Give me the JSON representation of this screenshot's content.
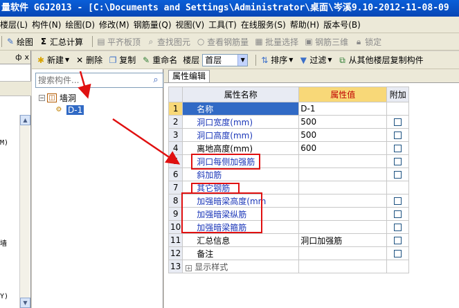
{
  "window": {
    "title": "量软件 GGJ2013 - [C:\\Documents and Settings\\Administrator\\桌面\\岑溪9.10-2012-11-08-09"
  },
  "menu": [
    "楼层(L)",
    "构件(N)",
    "绘图(D)",
    "修改(M)",
    "钢筋量(Q)",
    "视图(V)",
    "工具(T)",
    "在线服务(S)",
    "帮助(H)",
    "版本号(B)"
  ],
  "toolbar1": {
    "draw": "绘图",
    "summary": "汇总计算",
    "flat_slab": "平齐板顶",
    "find": "查找图元",
    "view_rebar": "查看钢筋量",
    "batch_select": "批量选择",
    "rebar_3d": "钢筋三维",
    "lock": "锁定"
  },
  "leftdock": {
    "pin": "ф",
    "close": "x",
    "snippets": [
      "M)",
      "墙",
      "Y)"
    ]
  },
  "toolbar2": {
    "new": "新建",
    "delete": "删除",
    "copy": "复制",
    "rename": "重命名",
    "floor_label": "楼层",
    "floor_value": "首层",
    "sort": "排序",
    "filter": "过滤",
    "copy_from_floor": "从其他楼层复制构件"
  },
  "tree": {
    "search_placeholder": "搜索构件...",
    "root": "墙洞",
    "child": "D-1",
    "expander": "−"
  },
  "properties": {
    "tab": "属性编辑",
    "headers": {
      "name": "属性名称",
      "value": "属性值",
      "extra": "附加"
    },
    "rows": [
      {
        "num": "1",
        "name": "名称",
        "value": "D-1",
        "checkbox": false
      },
      {
        "num": "2",
        "name": "洞口宽度(mm)",
        "value": "500",
        "checkbox": true
      },
      {
        "num": "3",
        "name": "洞口高度(mm)",
        "value": "500",
        "checkbox": true
      },
      {
        "num": "4",
        "name": "离地高度(mm)",
        "value": "600",
        "checkbox": true
      },
      {
        "num": "5",
        "name": "洞口每侧加强筋",
        "value": "",
        "checkbox": true
      },
      {
        "num": "6",
        "name": "斜加筋",
        "value": "",
        "checkbox": true
      },
      {
        "num": "7",
        "name": "其它钢筋",
        "value": "",
        "checkbox": false
      },
      {
        "num": "8",
        "name": "加强暗梁高度(mm",
        "value": "",
        "checkbox": true
      },
      {
        "num": "9",
        "name": "加强暗梁纵筋",
        "value": "",
        "checkbox": true
      },
      {
        "num": "10",
        "name": "加强暗梁箍筋",
        "value": "",
        "checkbox": true
      },
      {
        "num": "11",
        "name": "汇总信息",
        "value": "洞口加强筋",
        "checkbox": true
      },
      {
        "num": "12",
        "name": "备注",
        "value": "",
        "checkbox": true
      },
      {
        "num": "13",
        "name": "显示样式",
        "value": "",
        "checkbox": false
      }
    ]
  },
  "colors": {
    "selection": "#316ac5",
    "header_value": "#f8d878",
    "annotation": "#e01010",
    "property_blue": "#1a36b8"
  }
}
